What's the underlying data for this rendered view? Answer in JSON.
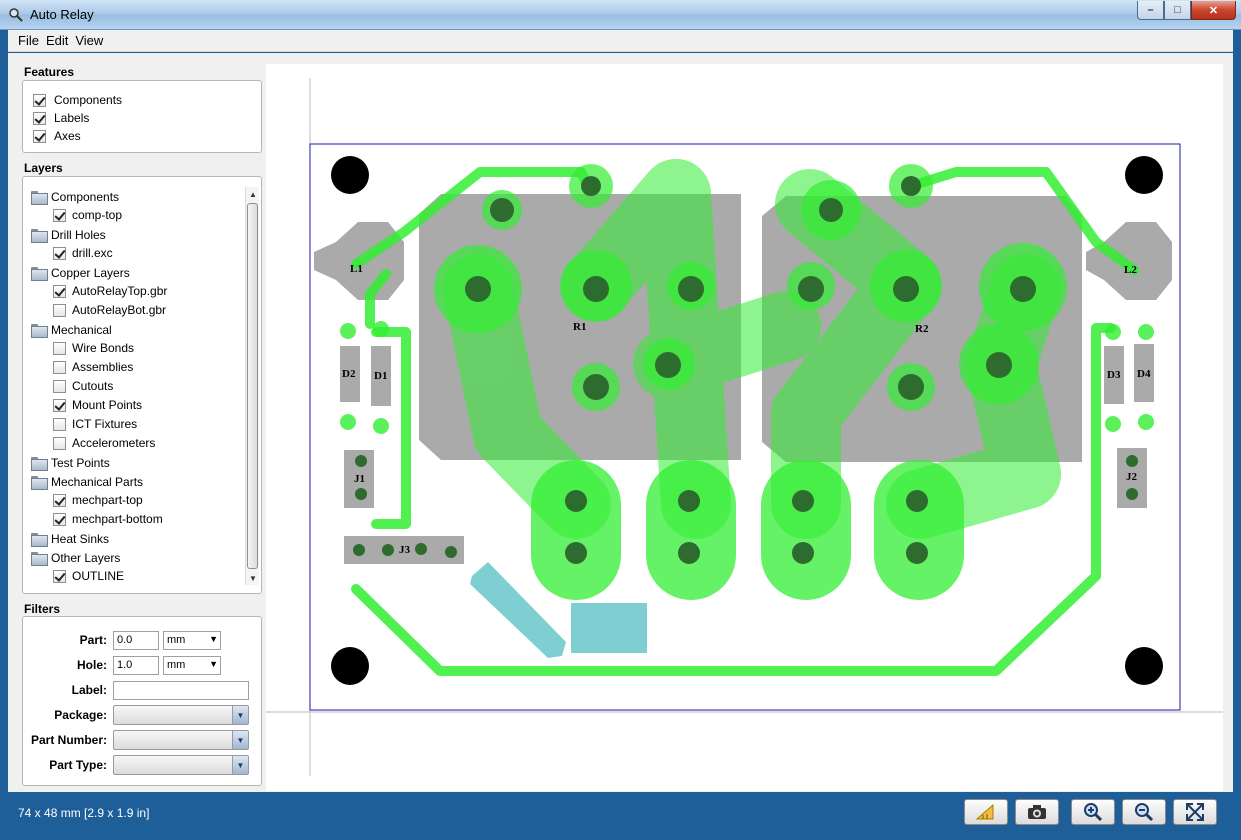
{
  "window": {
    "title": "Auto Relay",
    "controls": {
      "minimize": "–",
      "maximize": "□",
      "close": "✕"
    }
  },
  "menu": [
    "File",
    "Edit",
    "View"
  ],
  "features": {
    "title": "Features",
    "items": [
      {
        "label": "Components",
        "checked": true
      },
      {
        "label": "Labels",
        "checked": true
      },
      {
        "label": "Axes",
        "checked": true
      }
    ]
  },
  "layers": {
    "title": "Layers",
    "groups": [
      {
        "name": "Components",
        "items": [
          {
            "label": "comp-top",
            "checked": true
          }
        ]
      },
      {
        "name": "Drill Holes",
        "items": [
          {
            "label": "drill.exc",
            "checked": true
          }
        ]
      },
      {
        "name": "Copper Layers",
        "items": [
          {
            "label": "AutoRelayTop.gbr",
            "checked": true
          },
          {
            "label": "AutoRelayBot.gbr",
            "checked": false
          }
        ]
      },
      {
        "name": "Mechanical",
        "items": [
          {
            "label": "Wire Bonds",
            "checked": false
          },
          {
            "label": "Assemblies",
            "checked": false
          },
          {
            "label": "Cutouts",
            "checked": false
          },
          {
            "label": "Mount Points",
            "checked": true
          },
          {
            "label": "ICT Fixtures",
            "checked": false
          },
          {
            "label": "Accelerometers",
            "checked": false
          }
        ]
      },
      {
        "name": "Test Points",
        "items": []
      },
      {
        "name": "Mechanical Parts",
        "items": [
          {
            "label": "mechpart-top",
            "checked": true
          },
          {
            "label": "mechpart-bottom",
            "checked": true
          }
        ]
      },
      {
        "name": "Heat Sinks",
        "items": []
      },
      {
        "name": "Other Layers",
        "items": [
          {
            "label": "OUTLINE",
            "checked": true
          }
        ]
      }
    ]
  },
  "filters": {
    "title": "Filters",
    "part_label": "Part:",
    "part_value": "0.0",
    "part_unit": "mm",
    "hole_label": "Hole:",
    "hole_value": "1.0",
    "hole_unit": "mm",
    "label_label": "Label:",
    "label_value": "",
    "package_label": "Package:",
    "part_number_label": "Part Number:",
    "part_type_label": "Part Type:"
  },
  "board": {
    "labels": {
      "L1": "L1",
      "L2": "L2",
      "R1": "R1",
      "R2": "R2",
      "D1": "D1",
      "D2": "D2",
      "D3": "D3",
      "D4": "D4",
      "J1": "J1",
      "J2": "J2",
      "J3": "J3"
    },
    "colors": {
      "trace": "#22ee22",
      "component": "#aaaaaa",
      "mount": "#000000",
      "cyan": "#7fcfd2",
      "outline": "#1a1aa8"
    }
  },
  "status": {
    "dimensions": "74 x 48 mm  [2.9 x 1.9 in]",
    "tools": [
      "measure-icon",
      "camera-icon",
      "zoom-in-icon",
      "zoom-out-icon",
      "fit-screen-icon"
    ]
  }
}
